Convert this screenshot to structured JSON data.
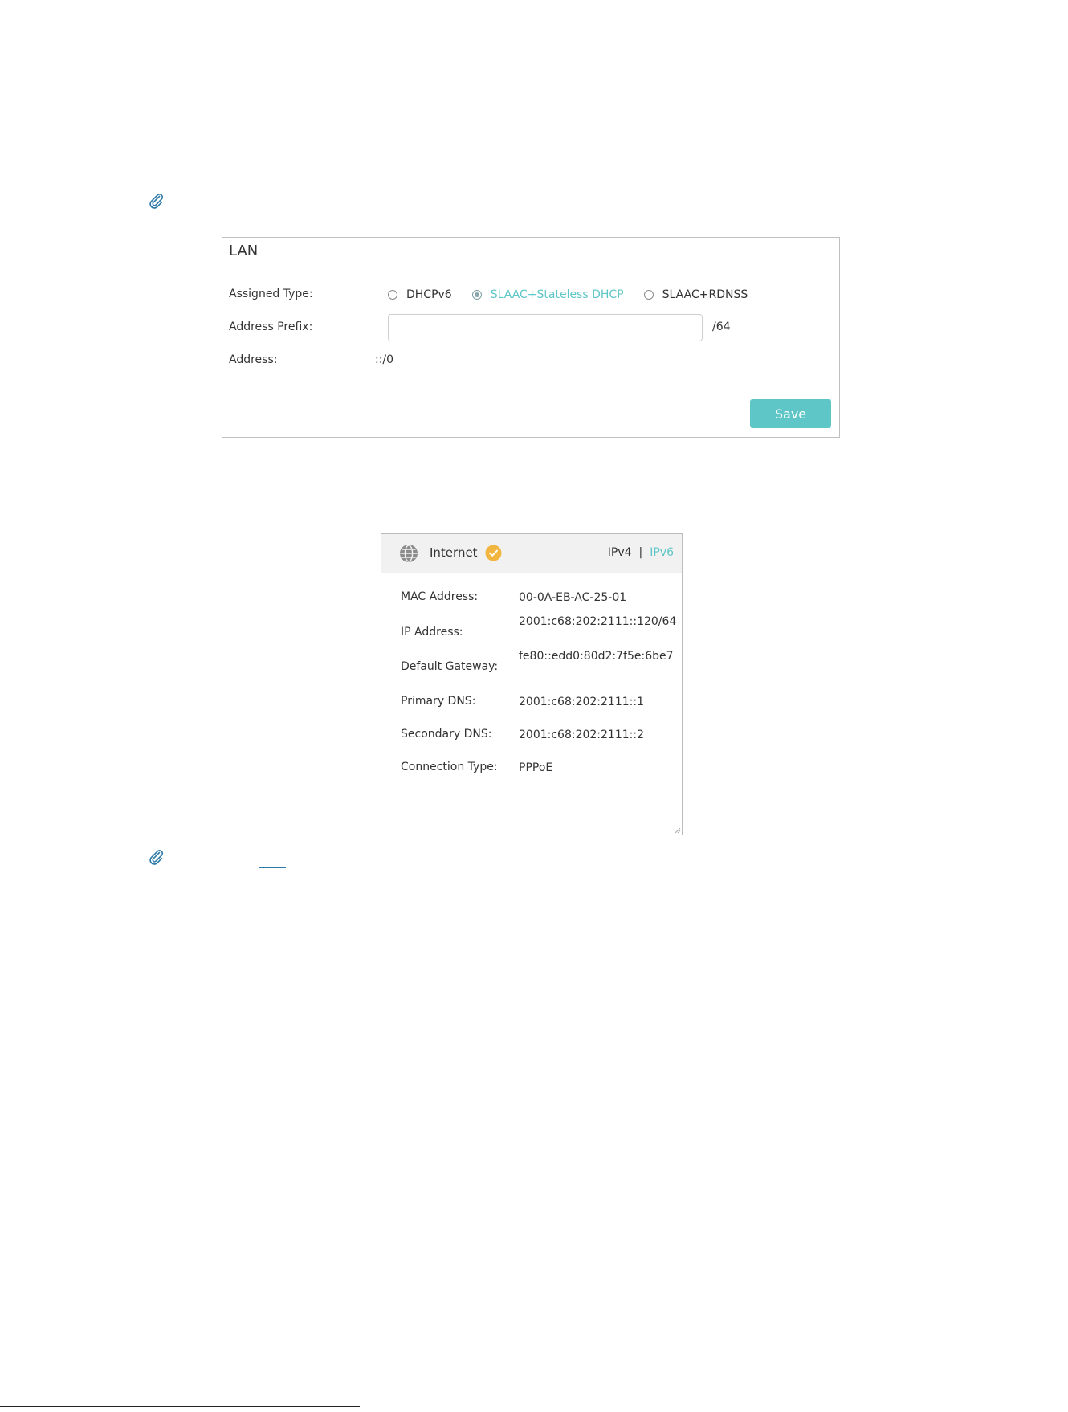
{
  "lan": {
    "title": "LAN",
    "assigned_type_label": "Assigned Type:",
    "assigned_type_options": [
      "DHCPv6",
      "SLAAC+Stateless DHCP",
      "SLAAC+RDNSS"
    ],
    "assigned_type_selected": "SLAAC+Stateless DHCP",
    "address_prefix_label": "Address Prefix:",
    "address_prefix_value": "",
    "address_prefix_suffix": "/64",
    "address_label": "Address:",
    "address_value": "::/0",
    "save_label": "Save"
  },
  "status": {
    "title": "Internet",
    "tabs": [
      "IPv4",
      "IPv6"
    ],
    "separator": "|",
    "active_tab": "IPv6",
    "rows": [
      {
        "label": "MAC Address:",
        "value": "00-0A-EB-AC-25-01"
      },
      {
        "label": "IP Address:",
        "value": "2001:c68:202:2111::120/64"
      },
      {
        "label": "Default Gateway:",
        "value": "fe80::edd0:80d2:7f5e:6be7"
      },
      {
        "label": "Primary DNS:",
        "value": "2001:c68:202:2111::1"
      },
      {
        "label": "Secondary DNS:",
        "value": "2001:c68:202:2111::2"
      },
      {
        "label": "Connection Type:",
        "value": "PPPoE"
      }
    ]
  },
  "icons": {
    "note": "paperclip-icon",
    "globe": "globe-icon",
    "connected": "check-circle-icon"
  },
  "colors": {
    "accent": "#5ec6c6",
    "note_icon": "#2d7aa8",
    "connected_badge": "#f2b53f",
    "header_bg": "#f1f1f1"
  }
}
